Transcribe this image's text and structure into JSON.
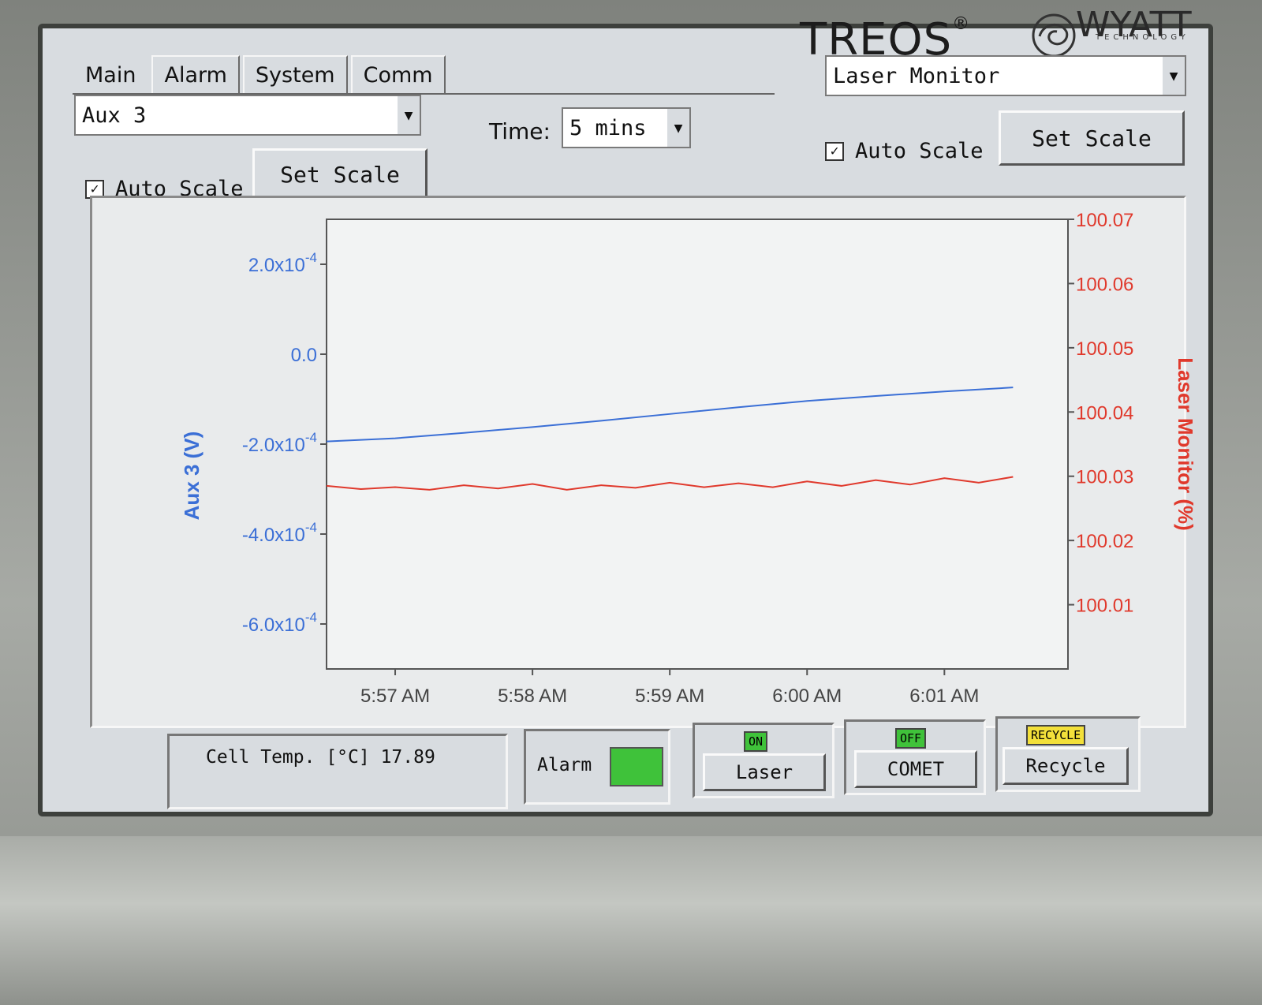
{
  "brand": {
    "name": "TREOS",
    "reg": "®",
    "company": "WYATT",
    "company_sub": "TECHNOLOGY"
  },
  "tabs": [
    {
      "label": "Main"
    },
    {
      "label": "Alarm"
    },
    {
      "label": "System"
    },
    {
      "label": "Comm"
    }
  ],
  "left_panel": {
    "selected": "Aux 3",
    "auto_scale_label": "Auto Scale",
    "auto_scale_checked": true,
    "set_scale_label": "Set Scale"
  },
  "time": {
    "label": "Time:",
    "value": "5 mins"
  },
  "right_panel": {
    "selected": "Laser Monitor",
    "auto_scale_label": "Auto Scale",
    "auto_scale_checked": true,
    "set_scale_label": "Set Scale"
  },
  "chart_data": {
    "type": "line",
    "x_tick_labels": [
      "5:57 AM",
      "5:58 AM",
      "5:59 AM",
      "6:00 AM",
      "6:01 AM"
    ],
    "xlim": [
      0,
      5.4
    ],
    "y_left": {
      "label": "Aux 3 (V)",
      "color": "#3b6fd6",
      "ylim": [
        -0.0007,
        0.0003
      ],
      "ticks": [
        {
          "value": 0.0002,
          "base": "2.0x10",
          "exp": "-4"
        },
        {
          "value": 0.0,
          "base": "0.0",
          "exp": ""
        },
        {
          "value": -0.0002,
          "base": "-2.0x10",
          "exp": "-4"
        },
        {
          "value": -0.0004,
          "base": "-4.0x10",
          "exp": "-4"
        },
        {
          "value": -0.0006,
          "base": "-6.0x10",
          "exp": "-4"
        }
      ]
    },
    "y_right": {
      "label": "Laser Monitor (%)",
      "color": "#e0392c",
      "ylim": [
        100.0,
        100.07
      ],
      "ticks": [
        "100.07",
        "100.06",
        "100.05",
        "100.04",
        "100.03",
        "100.02",
        "100.01"
      ]
    },
    "series": [
      {
        "name": "Aux 3",
        "axis": "left",
        "color": "#3b6fd6",
        "x": [
          0.0,
          0.5,
          1.0,
          1.5,
          2.0,
          2.5,
          3.0,
          3.5,
          4.0,
          4.5,
          5.0
        ],
        "y": [
          -0.000194,
          -0.000187,
          -0.000175,
          -0.000162,
          -0.000148,
          -0.000133,
          -0.000118,
          -0.000104,
          -9.3e-05,
          -8.3e-05,
          -7.4e-05
        ]
      },
      {
        "name": "Laser Monitor",
        "axis": "right",
        "color": "#e0392c",
        "x": [
          0.0,
          0.25,
          0.5,
          0.75,
          1.0,
          1.25,
          1.5,
          1.75,
          2.0,
          2.25,
          2.5,
          2.75,
          3.0,
          3.25,
          3.5,
          3.75,
          4.0,
          4.25,
          4.5,
          4.75,
          5.0
        ],
        "y": [
          100.0285,
          100.028,
          100.0283,
          100.0279,
          100.0286,
          100.0281,
          100.0288,
          100.0279,
          100.0286,
          100.0282,
          100.029,
          100.0283,
          100.0289,
          100.0283,
          100.0292,
          100.0285,
          100.0294,
          100.0287,
          100.0297,
          100.029,
          100.0299
        ]
      }
    ]
  },
  "status": {
    "cell_temp_label": "Cell Temp. [°C]",
    "cell_temp_value": "17.89",
    "alarm_label": "Alarm",
    "alarm_color": "#3fc23a",
    "laser": {
      "badge": "ON",
      "label": "Laser",
      "badge_color": "#3fc23a"
    },
    "comet": {
      "badge": "OFF",
      "label": "COMET",
      "badge_color": "#3fc23a"
    },
    "recycle": {
      "badge": "RECYCLE",
      "label": "Recycle",
      "badge_color": "#f3e03a"
    }
  }
}
